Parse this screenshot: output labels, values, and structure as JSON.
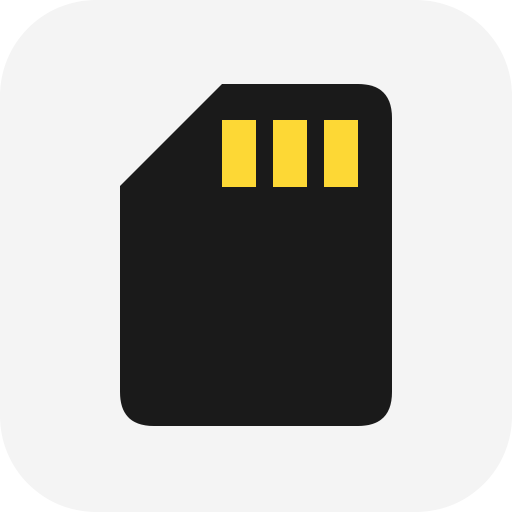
{
  "app_icon": {
    "icon": "sd-card-icon",
    "contact_count": 3,
    "colors": {
      "tile_background": "#f4f4f4",
      "card_body": "#1a1a1a",
      "contacts": "#fdd835"
    }
  }
}
